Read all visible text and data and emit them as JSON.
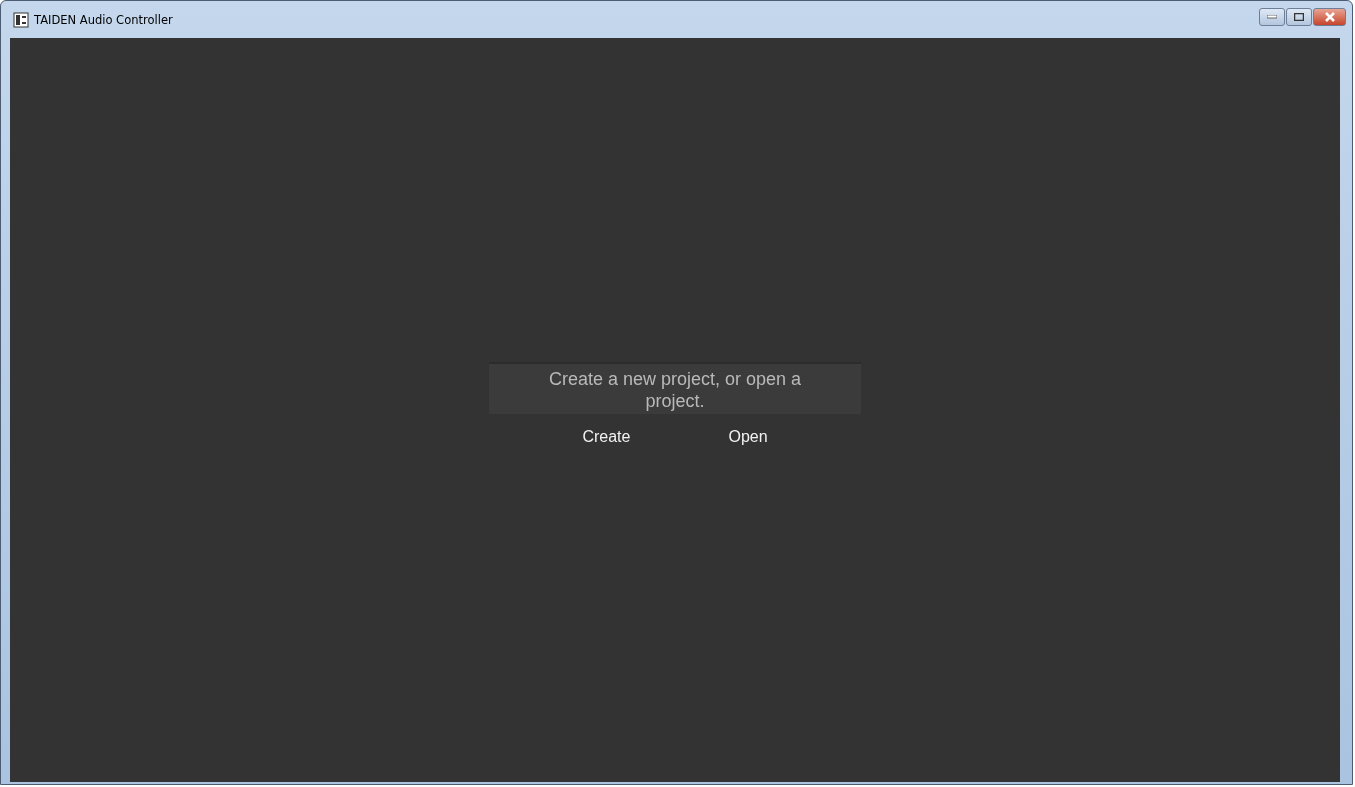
{
  "window": {
    "title": "TAIDEN Audio Controller"
  },
  "message": "Create a new project, or open a project.",
  "actions": [
    {
      "label": "Create"
    },
    {
      "label": "Open"
    }
  ]
}
